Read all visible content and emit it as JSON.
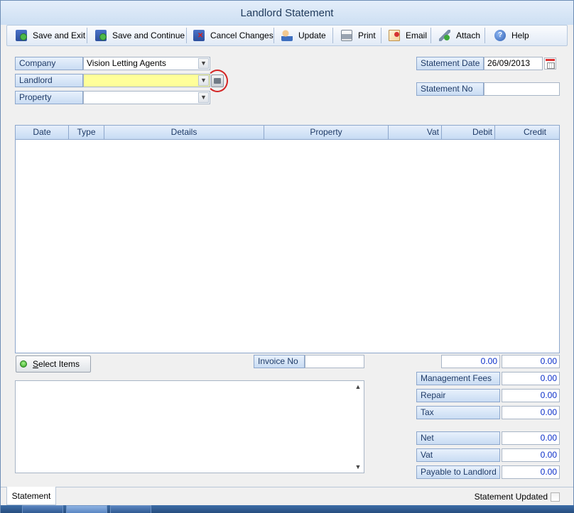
{
  "window": {
    "title": "Landlord Statement"
  },
  "toolbar": {
    "save_exit": "Save and Exit",
    "save_continue": "Save and Continue",
    "cancel_changes": "Cancel Changes",
    "update": "Update",
    "print": "Print",
    "email": "Email",
    "attach": "Attach",
    "help": "Help"
  },
  "form": {
    "company_label": "Company",
    "company_value": "Vision Letting Agents",
    "landlord_label": "Landlord",
    "landlord_value": "",
    "property_label": "Property",
    "property_value": "",
    "statement_date_label": "Statement Date",
    "statement_date_value": "26/09/2013",
    "statement_no_label": "Statement No",
    "statement_no_value": ""
  },
  "grid": {
    "columns": [
      "Date",
      "Type",
      "Details",
      "Property",
      "Vat",
      "Debit",
      "Credit"
    ],
    "rows": []
  },
  "actions": {
    "select_items": "Select Items",
    "invoice_no_label": "Invoice No",
    "invoice_no_value": ""
  },
  "totals": {
    "debit_total": "0.00",
    "credit_total": "0.00",
    "management_fees_label": "Management Fees",
    "management_fees": "0.00",
    "repair_label": "Repair",
    "repair": "0.00",
    "tax_label": "Tax",
    "tax": "0.00",
    "net_label": "Net",
    "net": "0.00",
    "vat_label": "Vat",
    "vat": "0.00",
    "payable_label": "Payable to Landlord",
    "payable": "0.00"
  },
  "footer": {
    "tab_statement": "Statement",
    "statement_updated_label": "Statement Updated",
    "statement_updated": false
  },
  "icons": {
    "save_exit": "save-check-icon",
    "save_continue": "save-continue-icon",
    "cancel": "cancel-icon",
    "update": "user-update-icon",
    "print": "printer-icon",
    "email": "envelope-icon",
    "attach": "paperclip-icon",
    "help": "help-icon"
  },
  "colors": {
    "label_bg": "#c9dcf3",
    "value_blue": "#0a2ec9",
    "required_field": "#ffff99",
    "annotation_circle": "#d42525"
  }
}
